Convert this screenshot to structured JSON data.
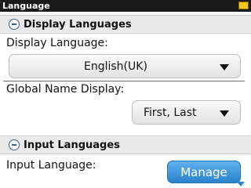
{
  "window": {
    "title": "Language",
    "notification_icon": "envelope-icon"
  },
  "display_section": {
    "header": "Display Languages",
    "display_language_label": "Display Language:",
    "display_language_value": "English(UK)",
    "global_name_label": "Global Name Display:",
    "global_name_value": "First, Last"
  },
  "input_section": {
    "header": "Input Languages",
    "input_language_label": "Input Language:",
    "manage_label": "Manage"
  },
  "colors": {
    "accent": "#2a83cd",
    "titlebar": "#1a1a1a"
  }
}
